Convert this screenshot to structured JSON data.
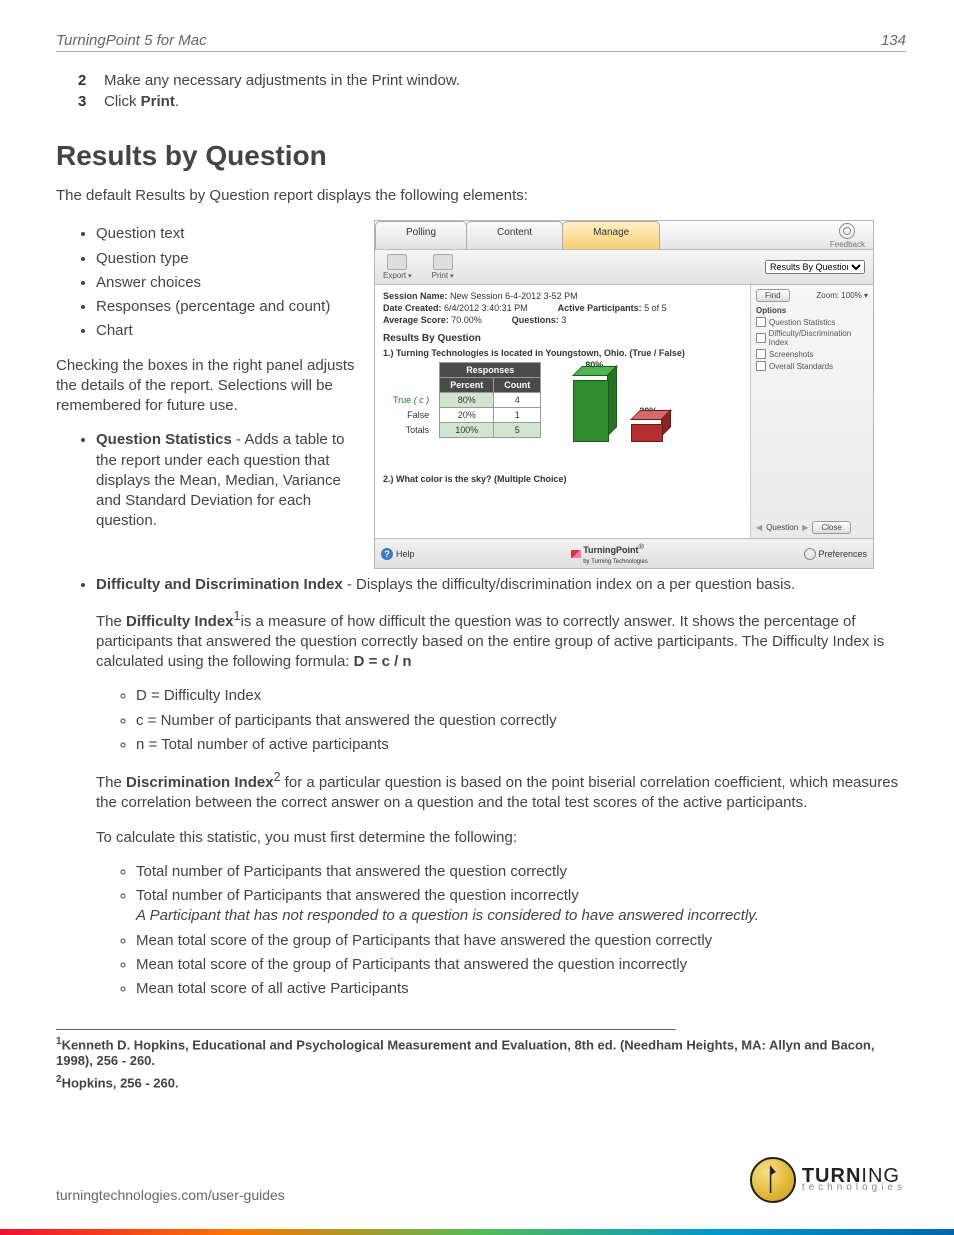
{
  "header": {
    "title": "TurningPoint 5 for Mac",
    "page": "134"
  },
  "steps": [
    {
      "num": "2",
      "text": "Make any necessary adjustments in the Print window."
    },
    {
      "num": "3",
      "prefix": "Click ",
      "bold": "Print",
      "suffix": "."
    }
  ],
  "section_heading": "Results by Question",
  "intro": "The default Results by Question report displays the following elements:",
  "elements_list": [
    "Question text",
    "Question type",
    "Answer choices",
    "Responses (percentage and count)",
    "Chart"
  ],
  "checking_para": "Checking the boxes in the right panel adjusts the details of the report. Selections will be remembered for future use.",
  "qstats": {
    "bold": "Question Statistics",
    "rest": " - Adds a table to the report under each question that displays the Mean, Median, Variance and Standard Deviation for each question."
  },
  "ddi_heading": {
    "bold": "Difficulty and Discrimination Index",
    "rest": " - Displays the difficulty/discrimination index on a per question basis."
  },
  "diff_para": {
    "p1a": "The ",
    "p1b": "Difficulty Index",
    "sup1": "1",
    "p1c": "is a measure of how difficult the question was to correctly answer. It shows the percentage of participants that answered the question correctly based on the entire group of active participants. The Difficulty Index is calculated using the following formula: ",
    "formula": "D = c / n"
  },
  "diff_vars": [
    "D = Difficulty Index",
    "c = Number of participants that answered the question correctly",
    "n = Total number of active participants"
  ],
  "discrim_para": {
    "a": "The ",
    "b": "Discrimination Index",
    "sup": "2",
    "c": " for a particular question is based on the point biserial correlation coefficient, which measures the correlation between the correct answer on a question and the total test scores of the active participants."
  },
  "calc_intro": "To calculate this statistic, you must first determine the following:",
  "calc_list": [
    {
      "text": "Total number of Participants that answered the question correctly"
    },
    {
      "text": "Total number of Participants that answered the question incorrectly",
      "italic": "A Participant that has not responded to a question is considered to have answered incorrectly."
    },
    {
      "text": "Mean total score of the group of Participants that have answered the question correctly"
    },
    {
      "text": "Mean total score of the group of Participants that answered the question incorrectly"
    },
    {
      "text": "Mean total score of all active Participants"
    }
  ],
  "footnotes": {
    "f1": "Kenneth D. Hopkins, Educational and Psychological Measurement and Evaluation, 8th ed. (Needham Heights, MA: Allyn and Bacon, 1998), 256 - 260.",
    "f2": "Hopkins, 256 - 260."
  },
  "footer_url": "turningtechnologies.com/user-guides",
  "brand": {
    "line1a": "TURN",
    "line1b": "ING",
    "line2": "technologies"
  },
  "screenshot": {
    "tabs": {
      "polling": "Polling",
      "content": "Content",
      "manage": "Manage"
    },
    "feedback": "Feedback",
    "toolbar": {
      "export": "Export",
      "print": "Print"
    },
    "report_dd": "Results By Question",
    "session": {
      "name_label": "Session Name:",
      "name": "New Session 6-4-2012 3-52 PM",
      "date_label": "Date Created:",
      "date": "6/4/2012 3:40:31 PM",
      "avg_label": "Average Score:",
      "avg": "70.00%",
      "ap_label": "Active Participants:",
      "ap": "5 of 5",
      "q_label": "Questions:",
      "q": "3"
    },
    "results_title": "Results By Question",
    "q1": "1.) Turning Technologies is located in Youngstown, Ohio. (True / False)",
    "q2": "2.) What color is the sky? (Multiple Choice)",
    "table": {
      "responses": "Responses",
      "percent": "Percent",
      "count": "Count",
      "true": "True",
      "c": "( c )",
      "false": "False",
      "totals": "Totals",
      "p_true": "80%",
      "c_true": "4",
      "p_false": "20%",
      "c_false": "1",
      "p_tot": "100%",
      "c_tot": "5"
    },
    "labels": {
      "l80": "80%",
      "l20": "20%"
    },
    "side": {
      "find": "Find",
      "zoom": "Zoom: 100%  ▾",
      "options": "Options",
      "o1": "Question Statistics",
      "o2": "Difficulty/Discrimination Index",
      "o3": "Screenshots",
      "o4": "Overall Standards"
    },
    "bottom": {
      "help": "Help",
      "tp": "TurningPoint",
      "by": "by Turning Technologies",
      "question": "Question",
      "close": "Close",
      "prefs": "Preferences"
    }
  },
  "chart_data": {
    "type": "bar",
    "categories": [
      "True",
      "False"
    ],
    "values": [
      80,
      20
    ],
    "ylabel": "Percent",
    "ylim": [
      0,
      100
    ]
  }
}
